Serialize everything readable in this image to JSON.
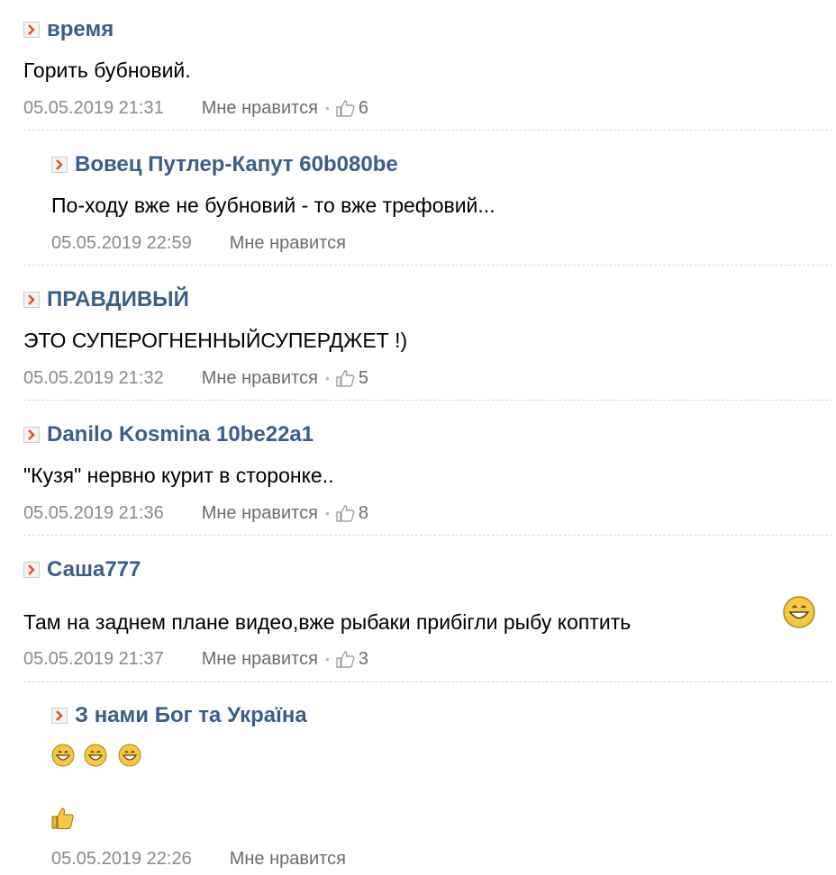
{
  "comments": [
    {
      "author": "время",
      "text": "Горить бубновий.",
      "date": "05.05.2019 21:31",
      "like_label": "Мне нравится",
      "likes": "6"
    },
    {
      "author": "Вовец Путлер-Капут 60b080be",
      "text": "По-ходу вже не бубновий - то вже трефовий...",
      "date": "05.05.2019 22:59",
      "like_label": "Мне нравится"
    },
    {
      "author": "ПРАВДИВЫЙ",
      "text": "ЭТО СУПЕРОГНЕННЫЙСУПЕРДЖЕТ !)",
      "date": "05.05.2019 21:32",
      "like_label": "Мне нравится",
      "likes": "5"
    },
    {
      "author": "Danilo Kosmina 10be22a1",
      "text": "\"Кузя\" нервно курит в сторонке..",
      "date": "05.05.2019 21:36",
      "like_label": "Мне нравится",
      "likes": "8"
    },
    {
      "author": "Саша777",
      "text": "Там на заднем плане видео,вже рыбаки прибігли рыбу коптить",
      "date": "05.05.2019 21:37",
      "like_label": "Мне нравится",
      "likes": "3"
    },
    {
      "author": "З нами Бог та Україна",
      "date": "05.05.2019 22:26",
      "like_label": "Мне нравится"
    }
  ],
  "icons": {
    "arrow": "arrow-right-icon",
    "thumb": "thumbs-up-icon",
    "grin": "grinning-emoji",
    "thumbs_emoji": "thumbs-up-emoji"
  },
  "colors": {
    "author": "#3b5f88",
    "meta": "#8a8a8a",
    "arrow": "#e0522a"
  }
}
